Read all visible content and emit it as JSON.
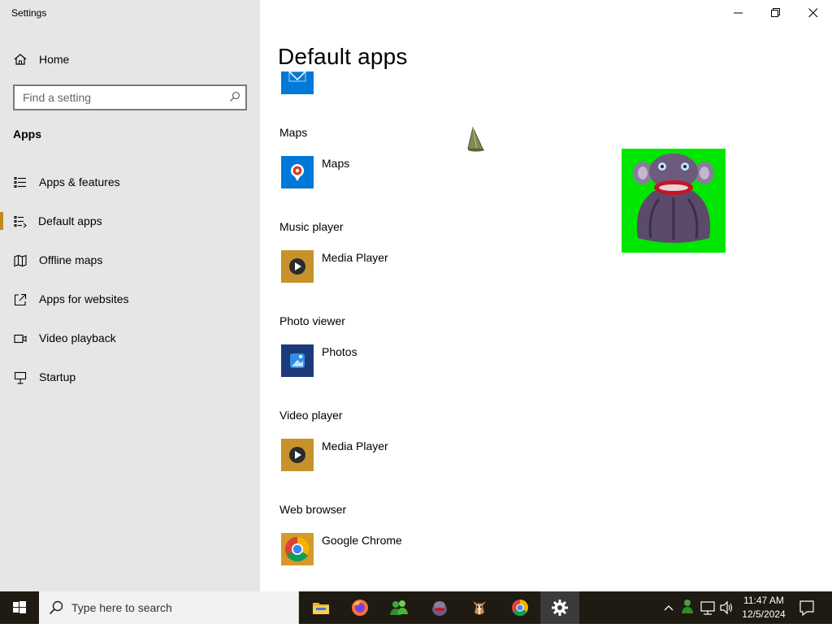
{
  "window": {
    "title": "Settings"
  },
  "sidebar": {
    "home_label": "Home",
    "search_placeholder": "Find a setting",
    "section_title": "Apps",
    "items": [
      {
        "label": "Apps & features",
        "icon": "list-icon"
      },
      {
        "label": "Default apps",
        "icon": "default-apps-icon",
        "active": true
      },
      {
        "label": "Offline maps",
        "icon": "map-icon"
      },
      {
        "label": "Apps for websites",
        "icon": "open-external-icon"
      },
      {
        "label": "Video playback",
        "icon": "video-icon"
      },
      {
        "label": "Startup",
        "icon": "startup-icon"
      }
    ]
  },
  "main": {
    "title": "Default apps",
    "categories": [
      {
        "label": "Maps",
        "app": "Maps",
        "icon": "maps-pin-icon",
        "tile_color": "#0078d7"
      },
      {
        "label": "Music player",
        "app": "Media Player",
        "icon": "media-player-icon",
        "tile_color": "#c8922a"
      },
      {
        "label": "Photo viewer",
        "app": "Photos",
        "icon": "photos-icon",
        "tile_color": "#1b3a7a"
      },
      {
        "label": "Video player",
        "app": "Media Player",
        "icon": "media-player-icon",
        "tile_color": "#c8922a"
      },
      {
        "label": "Web browser",
        "app": "Google Chrome",
        "icon": "chrome-icon",
        "tile_color": "#d49a2a"
      }
    ]
  },
  "taskbar": {
    "search_placeholder": "Type here to search",
    "pinned": [
      "file-explorer-icon",
      "firefox-icon",
      "people-icon",
      "monkey-app-icon",
      "dog-app-icon",
      "chrome-icon",
      "settings-gear-icon"
    ],
    "time": "11:47 AM",
    "date": "12/5/2024"
  },
  "colors": {
    "accent": "#c08a1e",
    "sidebar_bg": "#e6e6e6",
    "taskbar_bg": "#1f1a12"
  }
}
